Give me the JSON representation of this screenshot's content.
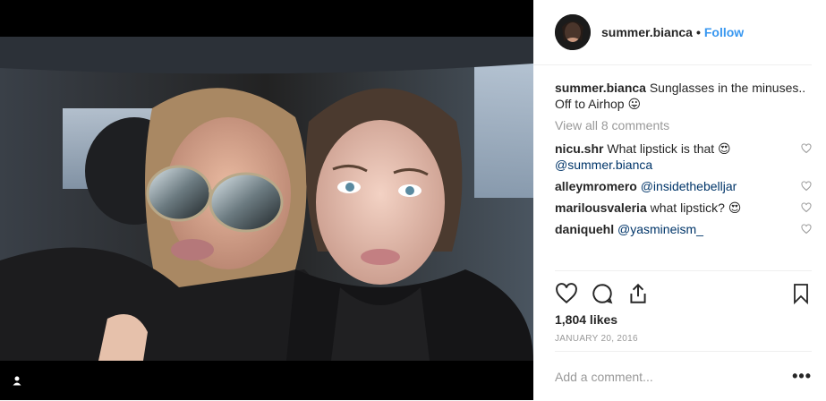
{
  "post": {
    "username": "summer.bianca",
    "dot": "•",
    "follow_label": "Follow",
    "caption_user": "summer.bianca",
    "caption_text": " Sunglasses in the minuses.. Off to Airhop 😛",
    "view_all": "View all 8 comments",
    "comments": [
      {
        "user": "nicu.shr",
        "text": " What lipstick is that 😍 ",
        "mention": "@summer.bianca"
      },
      {
        "user": "alleymromero",
        "text": " ",
        "mention": "@insidethebelljar"
      },
      {
        "user": "marilousvaleria",
        "text": " what lipstick? 😍",
        "mention": ""
      },
      {
        "user": "daniquehl",
        "text": " ",
        "mention": "@yasmineism_"
      }
    ],
    "likes": "1,804 likes",
    "date": "JANUARY 20, 2016",
    "add_comment_placeholder": "Add a comment...",
    "more": "•••"
  },
  "icons": {
    "like": "heart-icon",
    "comment": "comment-icon",
    "share": "share-icon",
    "save": "bookmark-icon",
    "tag": "user-tag-icon"
  }
}
